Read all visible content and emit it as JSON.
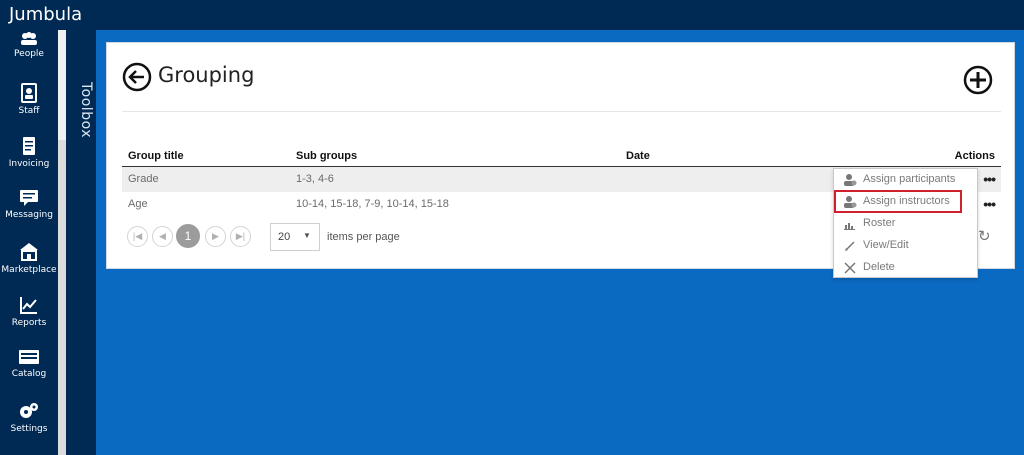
{
  "app": {
    "brand": "Jumbula"
  },
  "sidebar": {
    "items": [
      {
        "label": "People",
        "icon": "people-icon"
      },
      {
        "label": "Staff",
        "icon": "staff-icon"
      },
      {
        "label": "Invoicing",
        "icon": "invoice-icon"
      },
      {
        "label": "Messaging",
        "icon": "message-icon"
      },
      {
        "label": "Marketplace",
        "icon": "marketplace-icon"
      },
      {
        "label": "Reports",
        "icon": "reports-icon"
      },
      {
        "label": "Catalog",
        "icon": "catalog-icon"
      },
      {
        "label": "Settings",
        "icon": "settings-icon"
      }
    ]
  },
  "toolbox": {
    "label": "Toolbox"
  },
  "page": {
    "title": "Grouping"
  },
  "table": {
    "headers": {
      "group_title": "Group title",
      "sub_groups": "Sub groups",
      "date": "Date",
      "actions": "Actions"
    },
    "rows": [
      {
        "group_title": "Grade",
        "sub_groups": "1-3, 4-6",
        "date": "",
        "actions": "•••"
      },
      {
        "group_title": "Age",
        "sub_groups": "10-14, 15-18, 7-9, 10-14, 15-18",
        "date": "",
        "actions": "•••"
      }
    ]
  },
  "pager": {
    "current_page": "1",
    "per_page": "20",
    "per_page_label": "items per page"
  },
  "action_menu": {
    "items": [
      {
        "label": "Assign participants",
        "icon": "assign-participants-icon"
      },
      {
        "label": "Assign instructors",
        "icon": "assign-instructors-icon",
        "highlighted": true
      },
      {
        "label": "Roster",
        "icon": "roster-icon"
      },
      {
        "label": "View/Edit",
        "icon": "edit-icon"
      },
      {
        "label": "Delete",
        "icon": "delete-icon"
      }
    ]
  },
  "colors": {
    "topbar": "#002a54",
    "background": "#0a6ac2",
    "highlight": "#d0202e"
  }
}
